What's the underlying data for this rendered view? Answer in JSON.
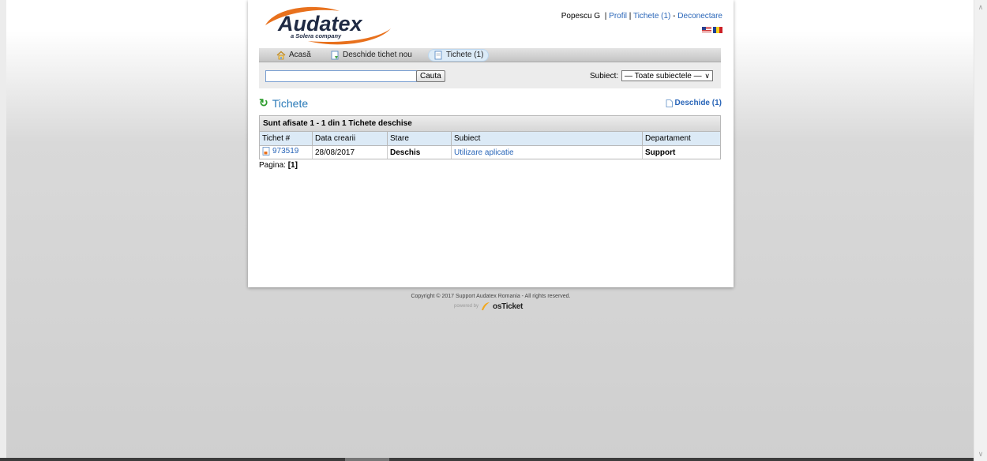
{
  "brand": {
    "name": "Audatex",
    "tagline": "a Solera company",
    "accent": "#e8711d"
  },
  "user": {
    "name": "Popescu G",
    "separator": "|",
    "profile": "Profil",
    "tickets": "Tichete (1)",
    "dash": "-",
    "logout": "Deconectare"
  },
  "nav": {
    "home": "Acasă",
    "new_ticket": "Deschide tichet nou",
    "tickets": "Tichete (1)"
  },
  "search": {
    "button": "Cauta",
    "subject_label": "Subiect:",
    "subject_selected": "— Toate subiectele —"
  },
  "page": {
    "title": "Tichete",
    "open_link": "Deschide (1)"
  },
  "table": {
    "caption": "Sunt afisate 1 - 1 din 1 Tichete deschise",
    "headers": [
      "Tichet #",
      "Data crearii",
      "Stare",
      "Subiect",
      "Departament"
    ],
    "rows": [
      {
        "ticket": "973519",
        "created": "28/08/2017",
        "status": "Deschis",
        "subject": "Utilizare aplicatie",
        "department": "Support"
      }
    ]
  },
  "pager": {
    "label": "Pagina:",
    "current": "[1]"
  },
  "footer": {
    "copyright": "Copyright © 2017 Support Audatex Romania - All rights reserved.",
    "powered_by": "powered by",
    "product": "osTicket"
  }
}
